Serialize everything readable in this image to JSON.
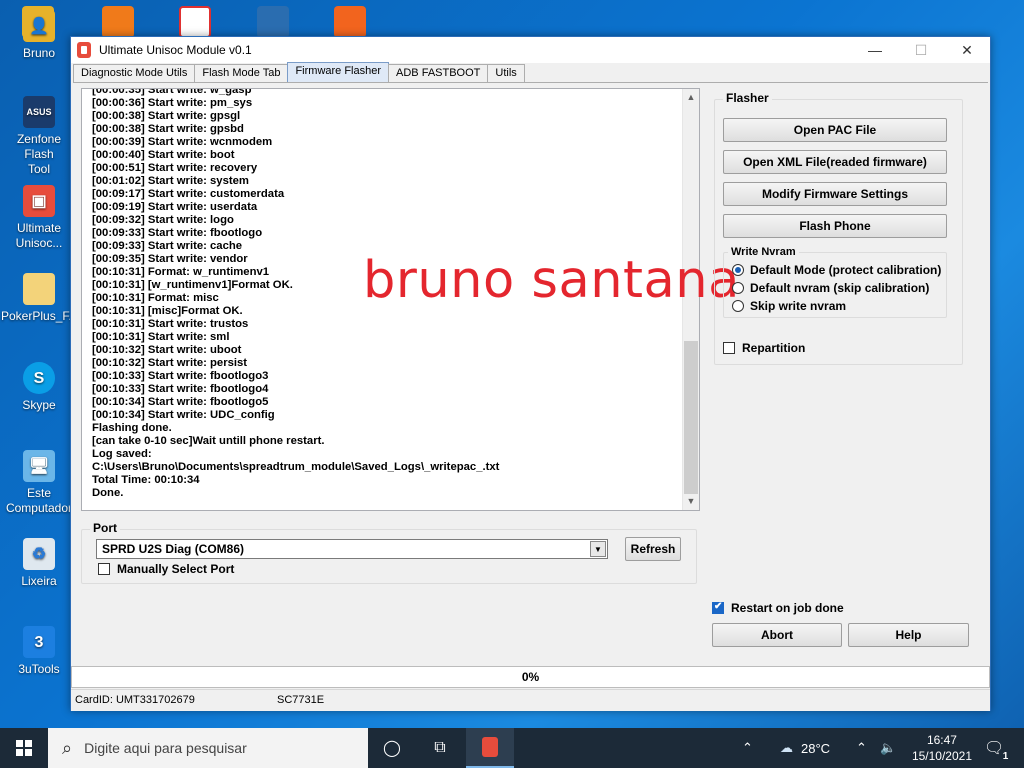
{
  "desktop": {
    "icons": [
      {
        "label": "Bruno"
      },
      {
        "label": "Zenfone Flash\nTool"
      },
      {
        "label": "Ultimate\nUnisoc..."
      },
      {
        "label": "PokerPlus_F..."
      },
      {
        "label": "Skype"
      },
      {
        "label": "Este\nComputador"
      },
      {
        "label": "Lixeira"
      },
      {
        "label": "3uTools"
      }
    ]
  },
  "window": {
    "title": "Ultimate Unisoc Module v0.1",
    "controls": {
      "minimize": "—",
      "maximize": "☐",
      "close": "✕"
    },
    "tabs": [
      "Diagnostic  Mode Utils",
      "Flash Mode Tab",
      "Firmware Flasher",
      "ADB FASTBOOT",
      "Utils"
    ],
    "active_tab": "Firmware Flasher",
    "log": "[00:00:35] Start write: w_gasp\n[00:00:36] Start write: pm_sys\n[00:00:38] Start write: gpsgl\n[00:00:38] Start write: gpsbd\n[00:00:39] Start write: wcnmodem\n[00:00:40] Start write: boot\n[00:00:51] Start write: recovery\n[00:01:02] Start write: system\n[00:09:17] Start write: customerdata\n[00:09:19] Start write: userdata\n[00:09:32] Start write: logo\n[00:09:33] Start write: fbootlogo\n[00:09:33] Start write: cache\n[00:09:35] Start write: vendor\n[00:10:31] Format: w_runtimenv1\n[00:10:31] [w_runtimenv1]Format OK.\n[00:10:31] Format: misc\n[00:10:31] [misc]Format OK.\n[00:10:31] Start write: trustos\n[00:10:31] Start write: sml\n[00:10:32] Start write: uboot\n[00:10:32] Start write: persist\n[00:10:33] Start write: fbootlogo3\n[00:10:33] Start write: fbootlogo4\n[00:10:34] Start write: fbootlogo5\n[00:10:34] Start write: UDC_config\nFlashing done.\n[can take 0-10 sec]Wait untill phone restart.\nLog saved:\nC:\\Users\\Bruno\\Documents\\spreadtrum_module\\Saved_Logs\\_writepac_.txt\nTotal Time: 00:10:34\nDone.",
    "watermark": "bruno santana",
    "flasher": {
      "group_label": "Flasher",
      "buttons": [
        "Open PAC File",
        "Open XML File(readed firmware)",
        "Modify Firmware Settings",
        "Flash Phone"
      ],
      "nvram_label": "Write Nvram",
      "nvram_options": [
        {
          "label": "Default Mode (protect calibration)",
          "checked": true
        },
        {
          "label": "Default nvram (skip calibration)",
          "checked": false
        },
        {
          "label": "Skip write nvram",
          "checked": false
        }
      ],
      "repartition_label": "Repartition",
      "repartition_checked": false
    },
    "port": {
      "group_label": "Port",
      "selected": "SPRD U2S Diag (COM86)",
      "refresh_label": "Refresh",
      "manual_label": "Manually Select Port",
      "manual_checked": false
    },
    "restart_label": "Restart on job done",
    "restart_checked": true,
    "abort_label": "Abort",
    "help_label": "Help",
    "progress": {
      "percent_text": "0%",
      "value": 0
    },
    "status": {
      "card_id": "CardID: UMT331702679",
      "chip": "SC7731E"
    }
  },
  "taskbar": {
    "search_placeholder": "Digite aqui para pesquisar",
    "weather": "28°C",
    "time": "16:47",
    "date": "15/10/2021",
    "notifications": "1"
  },
  "colors": {
    "accent": "#0078d7",
    "progress": "#06b025",
    "watermark": "#e4262e"
  }
}
